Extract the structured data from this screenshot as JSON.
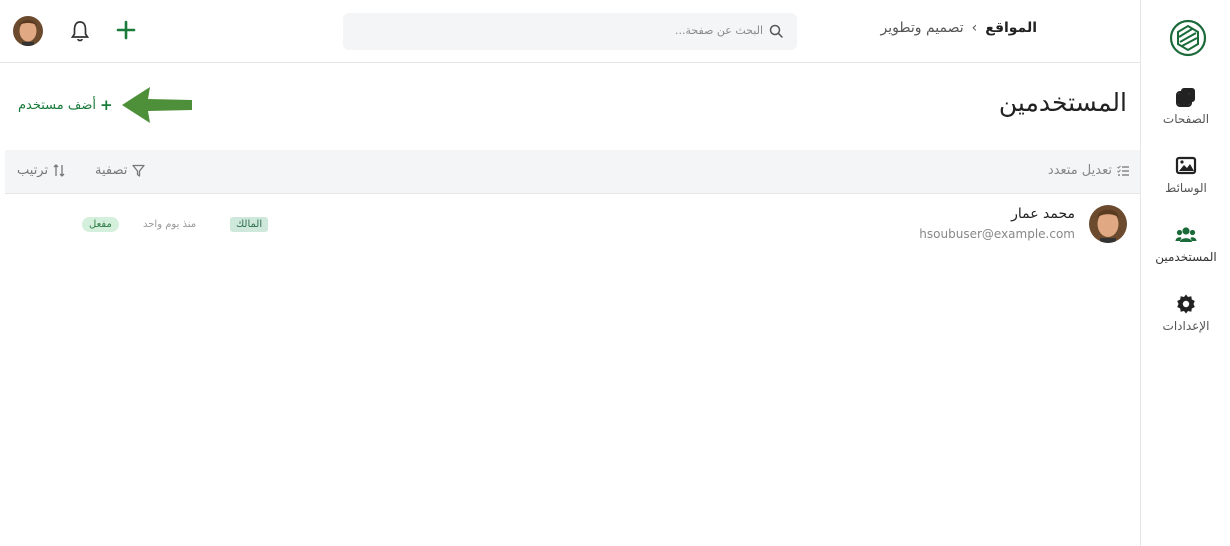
{
  "breadcrumb": {
    "root": "المواقع",
    "separator": "›",
    "current": "تصميم وتطوير"
  },
  "search": {
    "placeholder": "البحث عن صفحة..."
  },
  "sidebar": {
    "items": [
      {
        "label": "الصفحات",
        "icon": "pages-icon"
      },
      {
        "label": "الوسائط",
        "icon": "media-icon"
      },
      {
        "label": "المستخدمين",
        "icon": "users-icon",
        "active": true
      },
      {
        "label": "الإعدادات",
        "icon": "settings-icon"
      }
    ]
  },
  "page": {
    "title": "المستخدمين",
    "add_user": "أضف مستخدم"
  },
  "toolbar": {
    "bulk_edit": "تعديل متعدد",
    "filter": "تصفية",
    "sort": "ترتيب"
  },
  "users": [
    {
      "name": "محمد عمار",
      "email": "hsoubuser@example.com",
      "role": "المالك",
      "since": "منذ يوم واحد",
      "status": "مفعل"
    }
  ],
  "colors": {
    "accent": "#1a7a3a",
    "arrow": "#4e8f3a",
    "toolbar_bg": "#f4f5f6",
    "role_badge_bg": "#cfe8dc",
    "status_badge_bg": "#d4f0dc"
  }
}
